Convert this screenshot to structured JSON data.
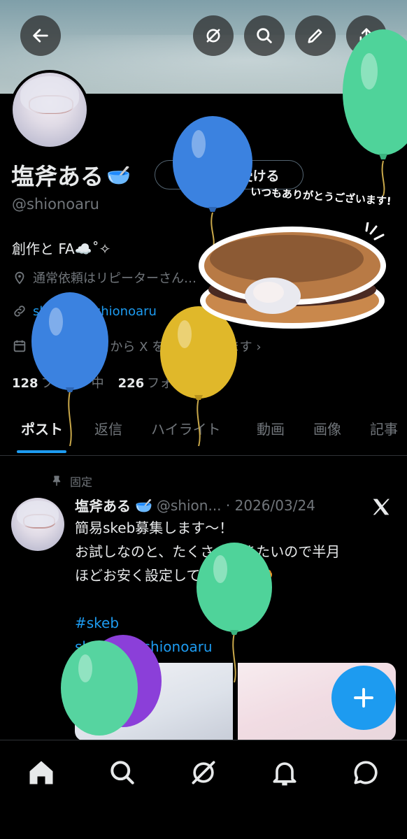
{
  "profile": {
    "name": "塩斧ある",
    "name_emoji": "🥣",
    "verify_label": "認証を受ける",
    "handle": "@shionoaru",
    "bio": "創作と FA☁️˚✧",
    "location": "通常依頼はリピーターさん…",
    "link": "skeb.jp/@shionoaru",
    "joined": "2024 年 8 月から X を利用しています ›",
    "following_count": "128",
    "following_label": "フォロー中",
    "followers_count": "226",
    "followers_label": "フォロワー"
  },
  "banner_buttons": [
    "back-icon",
    "grok-icon",
    "search-icon",
    "edit-icon",
    "share-icon"
  ],
  "tabs": [
    {
      "label": "ポスト",
      "active": true
    },
    {
      "label": "返信",
      "active": false
    },
    {
      "label": "ハイライト",
      "active": false
    },
    {
      "label": "動画",
      "active": false
    },
    {
      "label": "画像",
      "active": false
    },
    {
      "label": "記事",
      "active": false
    }
  ],
  "post": {
    "pinned_label": "固定",
    "author": "塩斧ある",
    "author_emoji": "🥣",
    "handle_date": "@shion... · 2026/03/24",
    "lines": [
      "簡易skeb募集します〜！",
      "お試しなのと、たくさん描きたいので半月",
      "ほどお安く設定しております🥐",
      "",
      "#skeb",
      "skeb.jp/@shionoaru"
    ]
  },
  "sticker": {
    "text": "いつもありがとうございます!"
  },
  "bottom_nav": [
    "home-icon",
    "search-icon",
    "grok-icon",
    "notifications-icon",
    "messages-icon"
  ],
  "colors": {
    "accent": "#1d9bf0",
    "secondary_text": "#71767b",
    "divider": "#2f3336",
    "balloon_green": "#4fd39a",
    "balloon_blue": "#3b82e0",
    "balloon_yellow": "#e0b82a",
    "balloon_purple": "#8b3fd9"
  }
}
